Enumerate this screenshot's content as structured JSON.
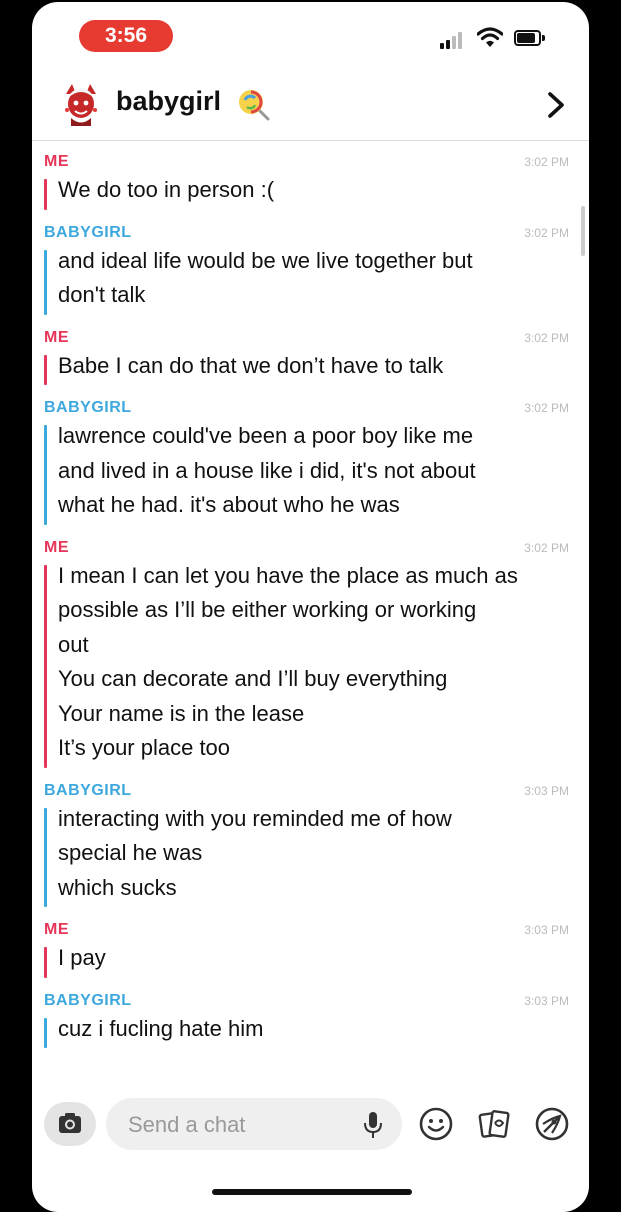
{
  "status_bar": {
    "time": "3:56",
    "accent_color": "#e73b32"
  },
  "header": {
    "contact_name": "babygirl",
    "emoji_icon": "lollipop-icon",
    "nav_icon": "chevron-right-icon"
  },
  "colors": {
    "me": "#e5365a",
    "babygirl": "#3da8de"
  },
  "messages": [
    {
      "sender": "ME",
      "time": "3:02 PM",
      "lines": [
        "We do too in person :("
      ]
    },
    {
      "sender": "BABYGIRL",
      "time": "3:02 PM",
      "lines": [
        "and ideal life would be we live together but",
        "don't talk"
      ]
    },
    {
      "sender": "ME",
      "time": "3:02 PM",
      "lines": [
        "Babe I can do that we don’t have to talk"
      ]
    },
    {
      "sender": "BABYGIRL",
      "time": "3:02 PM",
      "lines": [
        "lawrence could've been a poor boy like me",
        "and lived in a house like i did, it's not about",
        "what he had. it's about who he was"
      ]
    },
    {
      "sender": "ME",
      "time": "3:02 PM",
      "lines": [
        "I mean I can let you have the place as much as",
        "possible as I’ll be either working or working",
        "out",
        "You can decorate and I’ll buy everything",
        "Your name is in the lease",
        "It’s your place too"
      ]
    },
    {
      "sender": "BABYGIRL",
      "time": "3:03 PM",
      "lines": [
        "interacting with you reminded me of how",
        "special he was",
        "which sucks"
      ]
    },
    {
      "sender": "ME",
      "time": "3:03 PM",
      "lines": [
        "I pay"
      ]
    },
    {
      "sender": "BABYGIRL",
      "time": "3:03 PM",
      "lines": [
        "cuz i fucling hate him"
      ]
    }
  ],
  "input": {
    "placeholder": "Send a chat",
    "icons": [
      "camera-icon",
      "microphone-icon",
      "smiley-icon",
      "sticker-cards-icon",
      "rocket-icon"
    ]
  }
}
